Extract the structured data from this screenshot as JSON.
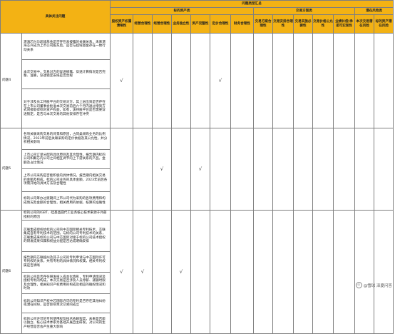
{
  "header": {
    "concern_title": "具体关注问题",
    "summary": "问题类型汇总",
    "groups": [
      "标的资产类",
      "交易方案类",
      "潜在风险类"
    ],
    "columns": [
      "股权资产权属清晰性",
      "经营合理性",
      "经营合理性",
      "业务独立性",
      "资产完整性",
      "定价合理性",
      "财务合理性",
      "交易方案合理性",
      "交易安排合理性",
      "交易实施必要性",
      "交易价格公允性",
      "业绩补偿/承诺可实现性",
      "本次交易潜在风险",
      "标的资产潜在风险"
    ]
  },
  "rows": [
    {
      "label": "问题4",
      "check_columns": [
        0,
        5
      ],
      "subs": [
        "渭海芯兴与超域基金是否存在未披露的关联关系，未来渭海芯兴成为上市公司股东后，是否与超域基金存在一致行动关系",
        "本次交易中，交易对方的穿透披露、穿透计算情况是否完整、准确，穿透锁定安排是否合规",
        "对于涉及员工持股平台的交易对方，其上层出资是否存在在上市公司董事会批准本次交易前后六个月内通过增资方式间接取得标的资产权益，如有，该持股平台是否需要穿透锁定，是否与本次交易的其他安排存在冲突"
      ]
    },
    {
      "label": "问题5",
      "check_columns": [
        2,
        4
      ],
      "subs": [
        "各项关联采购交易的背景和原因，占同类采购业务的比例情况，2023年前后关联采购的定价依据及其公允性，并分析相关影响",
        "上市公司订单分配的具体原则及其合理性，报告期内标的公司和聚芯内公司之间相互调节的上下游关系的产品，金额及占比情况",
        "上市公司采购是否能积极的具体情况，报告期内相关交易的金额及构成，标的公司业务的具体金额，2023年前后各项需开始的具体方法及合理性",
        "标的公司筹办过渡期间上市公司代为采购的各项费用和构成情况及金额的合理性，相关费用的依据、核算的准确性"
      ]
    },
    {
      "label": "问题6",
      "check_columns": [
        0,
        1,
        3
      ],
      "subs": [
        "标的公司的IGBT、硅基晶圆代工业务核心技术来源于外部授权的原因",
        "芯联集成授权给标的公司的中芯国际相关专利技术、芯联集成自有专利技术的范围，与标的公司专利技术的关系，芯联集成来标的公司与中芯国际对接于标的公司技术授权的研发成果归属和权益分配是否达成明确安排",
        "报告期内芯联越州及其子公司的专利申请与中芯国际许可专利权的关系，共有专利的具体情况和权属，相关专利权属是否清晰",
        "标的公司是否存在研发投入成本化情形，专利申请情况及授权专利的构成，本次交易是否涉及人员停薪、捕钢时限及合理性，相关知识产权费用的构成及相应的确权情况和时效",
        "标的公司知识产权中芯国际许可的专利是否存在其他纠纷或潜在纠纷，是否影响本次交易的成立",
        "标的公司许可的专利使用权及技术依赖程度，未来是否能以独立、核心技术体系为基础开展自主研发，对公司的生产经营是否会产生重大影响"
      ]
    }
  ],
  "check_mark": "√",
  "watermark": "@雪球 泽夏问答"
}
